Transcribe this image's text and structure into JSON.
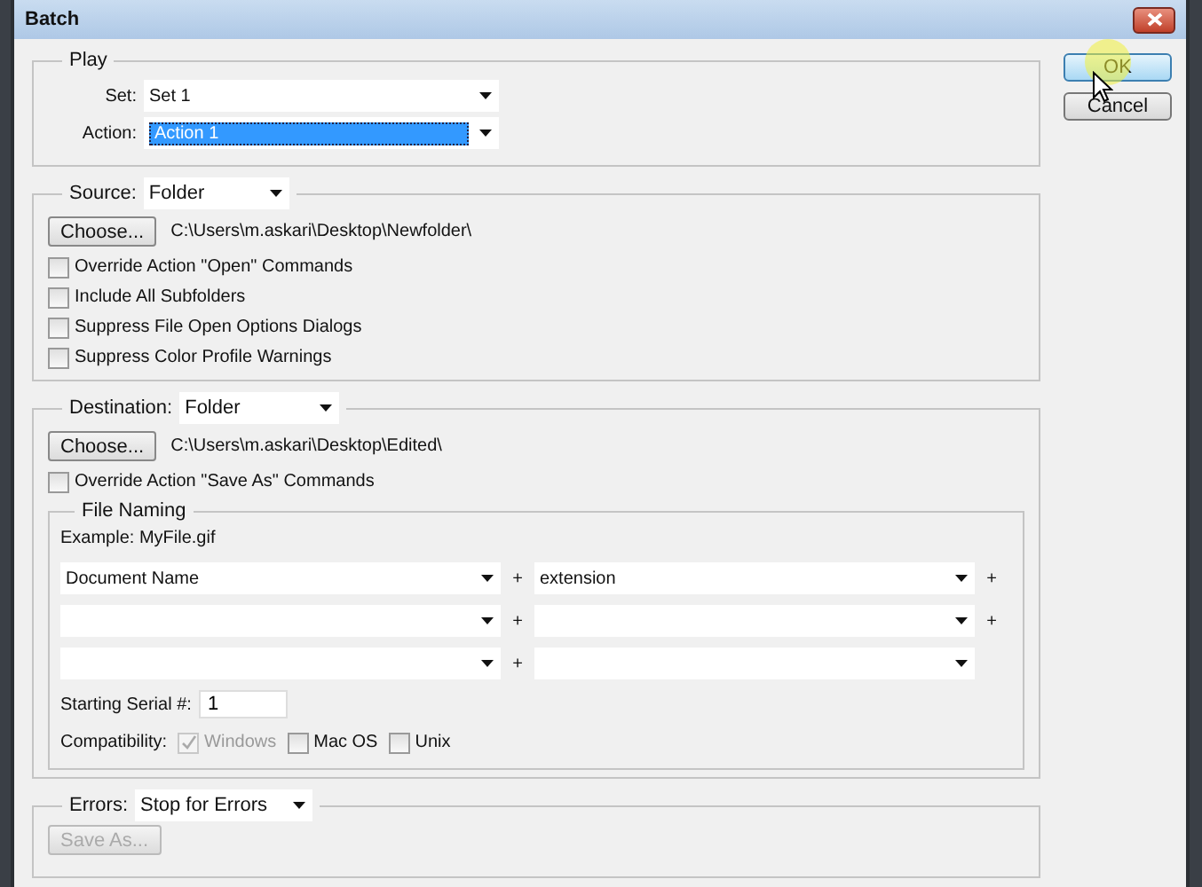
{
  "window": {
    "title": "Batch"
  },
  "play": {
    "title": "Play",
    "set": {
      "label": "Set:",
      "value": "Set 1"
    },
    "action": {
      "label": "Action:",
      "value": "Action 1",
      "selected": true
    }
  },
  "source": {
    "label": "Source:",
    "value": "Folder",
    "choose_button": "Choose...",
    "path": "C:\\Users\\m.askari\\Desktop\\Newfolder\\",
    "options": [
      {
        "label": "Override Action \"Open\" Commands",
        "checked": false
      },
      {
        "label": "Include All Subfolders",
        "checked": false
      },
      {
        "label": "Suppress File Open Options Dialogs",
        "checked": false
      },
      {
        "label": "Suppress Color Profile Warnings",
        "checked": false
      }
    ]
  },
  "destination": {
    "label": "Destination:",
    "value": "Folder",
    "choose_button": "Choose...",
    "path": "C:\\Users\\m.askari\\Desktop\\Edited\\",
    "options": [
      {
        "label": "Override Action \"Save As\" Commands",
        "checked": false
      }
    ],
    "file_naming": {
      "title": "File Naming",
      "example": "Example: MyFile.gif",
      "rows": [
        {
          "field_1": "Document Name",
          "plus_1": "+",
          "field_2": "extension",
          "plus_2": "+"
        },
        {
          "plus_1": "+",
          "plus_2": "+"
        },
        {
          "plus_1": "+"
        }
      ],
      "serial": {
        "label": "Starting Serial #:",
        "value": "1"
      },
      "compatibility": {
        "label": "Compatibility:",
        "options": [
          {
            "label": "Windows",
            "checked": true,
            "disabled": true
          },
          {
            "label": "Mac OS",
            "checked": false,
            "disabled": false
          },
          {
            "label": "Unix",
            "checked": false,
            "disabled": false
          }
        ]
      }
    }
  },
  "errors": {
    "label": "Errors:",
    "value": "Stop for Errors",
    "save_button": {
      "label": "Save As...",
      "disabled": true
    }
  },
  "buttons": [
    {
      "label": "OK",
      "default": true
    },
    {
      "label": "Cancel",
      "default": false
    }
  ]
}
